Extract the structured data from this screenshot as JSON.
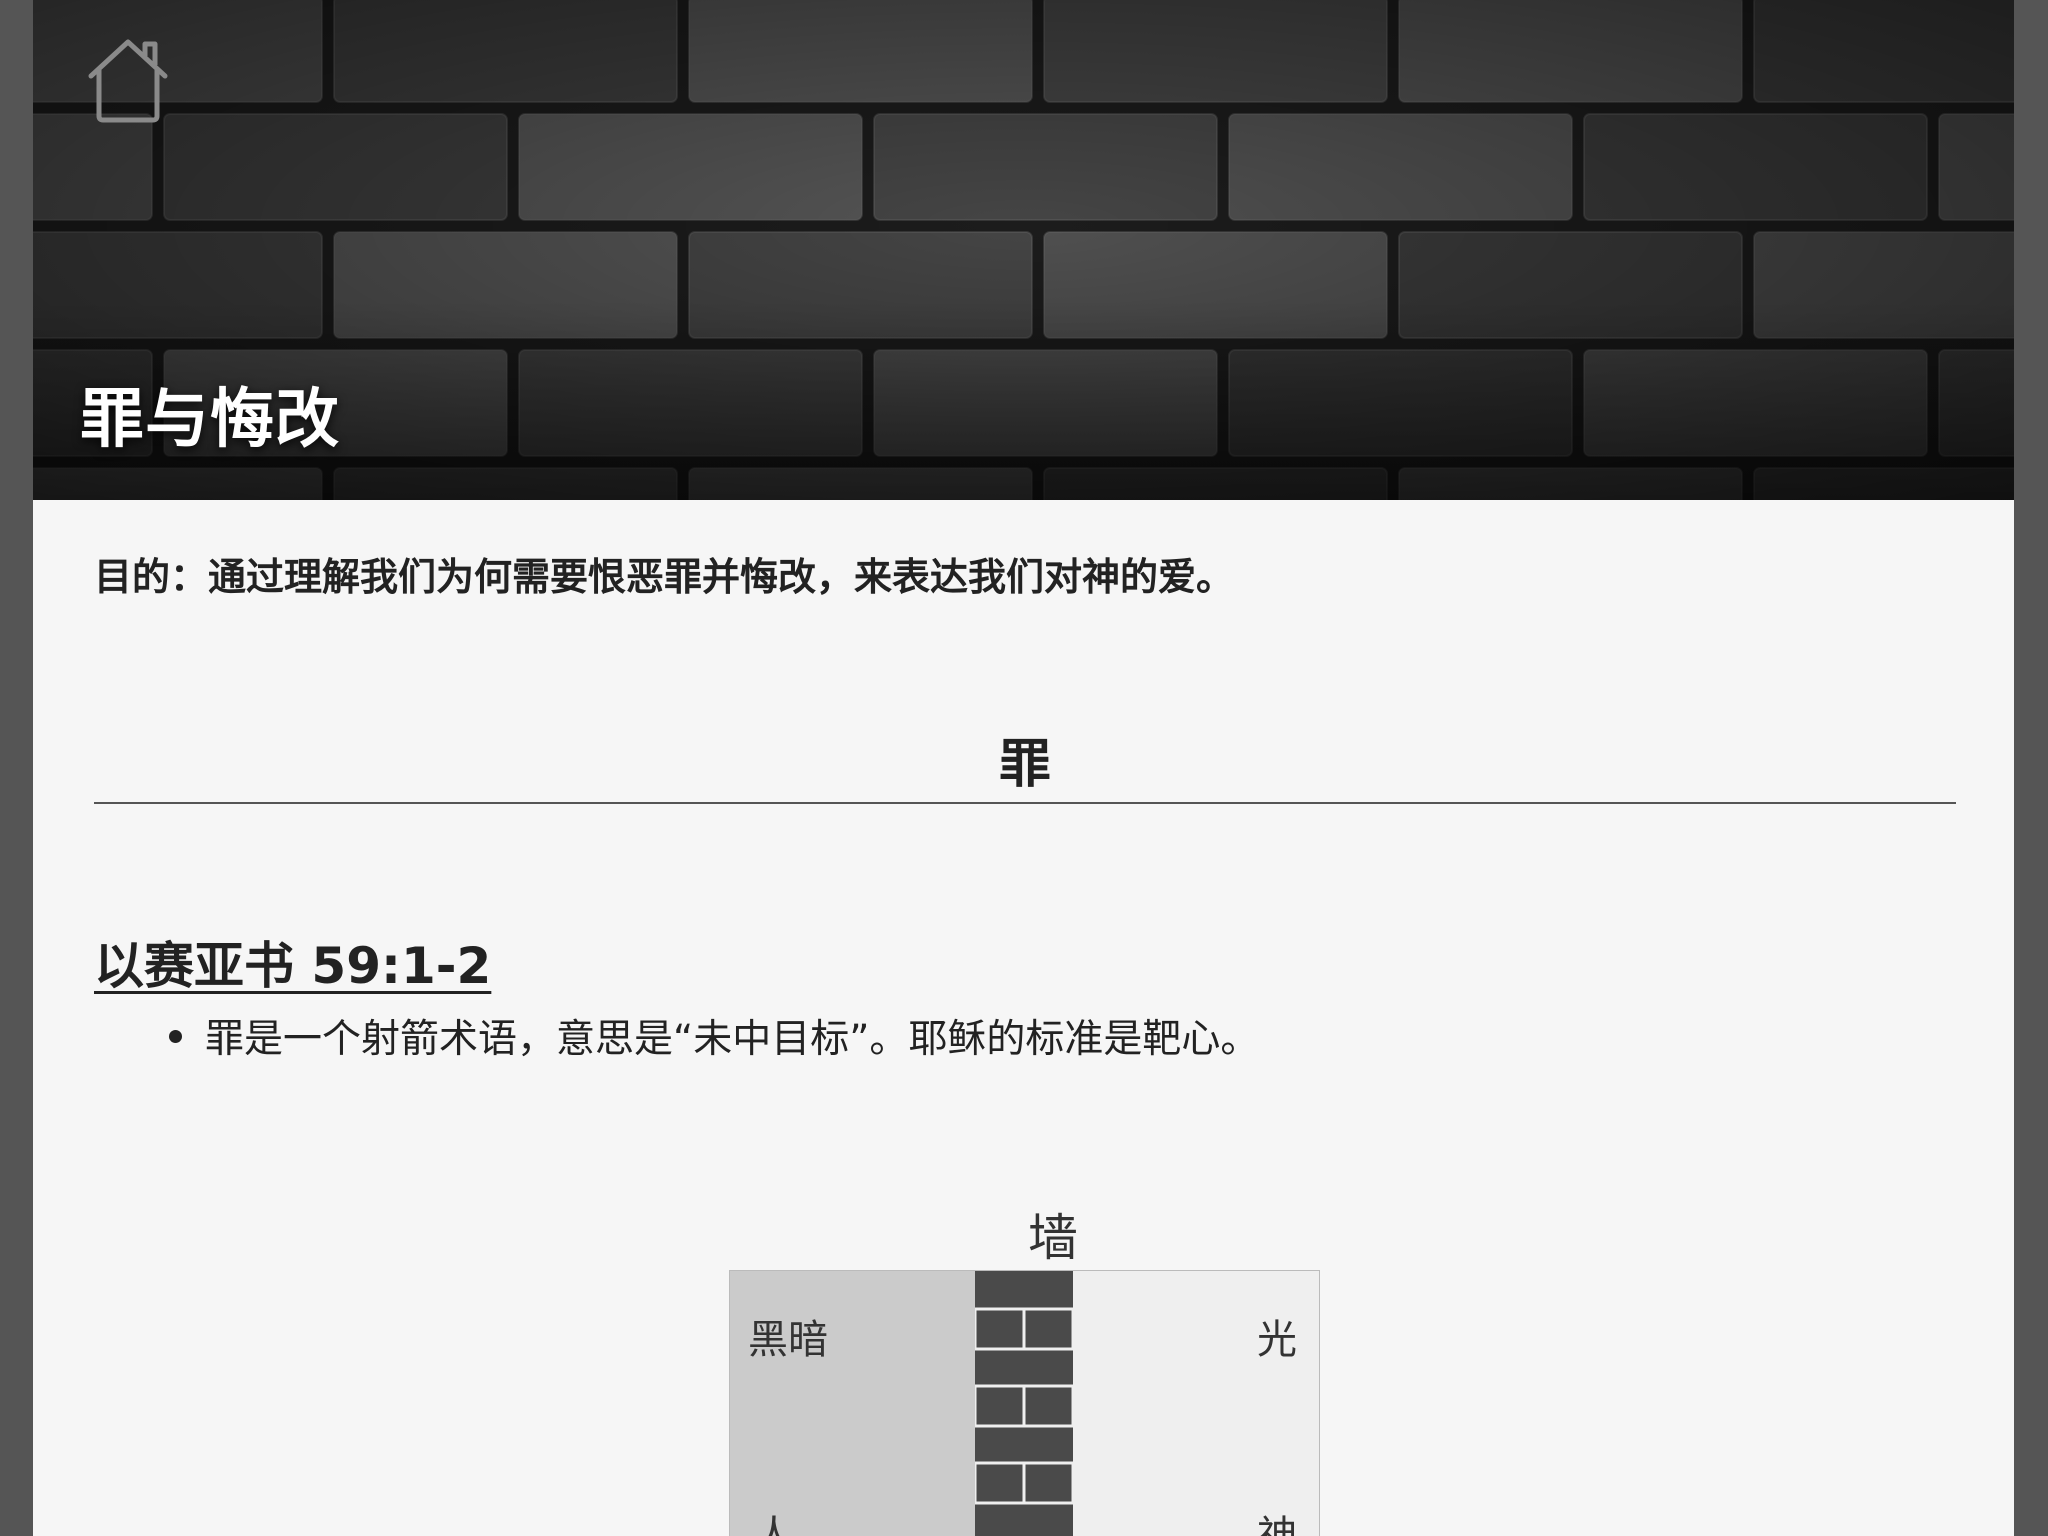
{
  "hero": {
    "title": "罪与悔改",
    "home_icon": "home-icon"
  },
  "purpose": "目的：通过理解我们为何需要恨恶罪并悔改，来表达我们对神的爱。",
  "section": {
    "heading": "罪"
  },
  "scripture": {
    "reference": "以赛亚书 59:1-2",
    "bullets": [
      "罪是一个射箭术语，意思是“未中目标”。耶稣的标准是靶心。"
    ]
  },
  "diagram": {
    "title": "墙",
    "left_top": "黑暗",
    "left_bottom": "人",
    "right_top": "光",
    "right_bottom": "神"
  },
  "colors": {
    "frame": "#555555",
    "page_bg": "#f6f6f6",
    "dark_side": "#cbcbcb",
    "light_side": "#efefef",
    "wall": "#4a4a4a"
  }
}
